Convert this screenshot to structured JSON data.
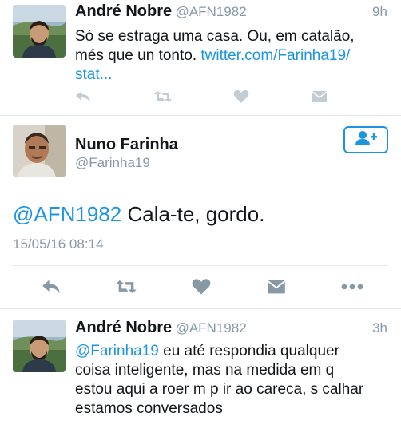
{
  "tweet1": {
    "name": "André Nobre",
    "handle": "@AFN1982",
    "time": "9h",
    "text_line1": "Só se estraga uma casa. Ou, em catalão,",
    "text_line2_plain": "més que un tonto. ",
    "text_line2_link": "twitter.com/Farinha19/",
    "text_line3_link": "stat..."
  },
  "main": {
    "name": "Nuno Farinha",
    "handle": "@Farinha19",
    "mention": "@AFN1982",
    "text": " Cala-te, gordo.",
    "timestamp": "15/05/16 08:14"
  },
  "tweet3": {
    "name": "André Nobre",
    "handle": "@AFN1982",
    "time": "3h",
    "mention": "@Farinha19",
    "line1_rest": " eu até respondia qualquer",
    "line2": "coisa inteligente, mas na medida em q",
    "line3": "estou aqui a roer m p ir ao careca, s calhar",
    "line4": "estamos conversados"
  },
  "icons": {
    "reply": "reply-icon",
    "retweet": "retweet-icon",
    "like": "heart-icon",
    "dm": "envelope-icon",
    "more": "more-icon",
    "follow": "follow-user-icon"
  },
  "colors": {
    "link": "#1b95e0",
    "muted": "#8899a6",
    "icon_light": "#c1ccd5",
    "icon_dark": "#8899a6",
    "divider": "#e1e8ed"
  }
}
